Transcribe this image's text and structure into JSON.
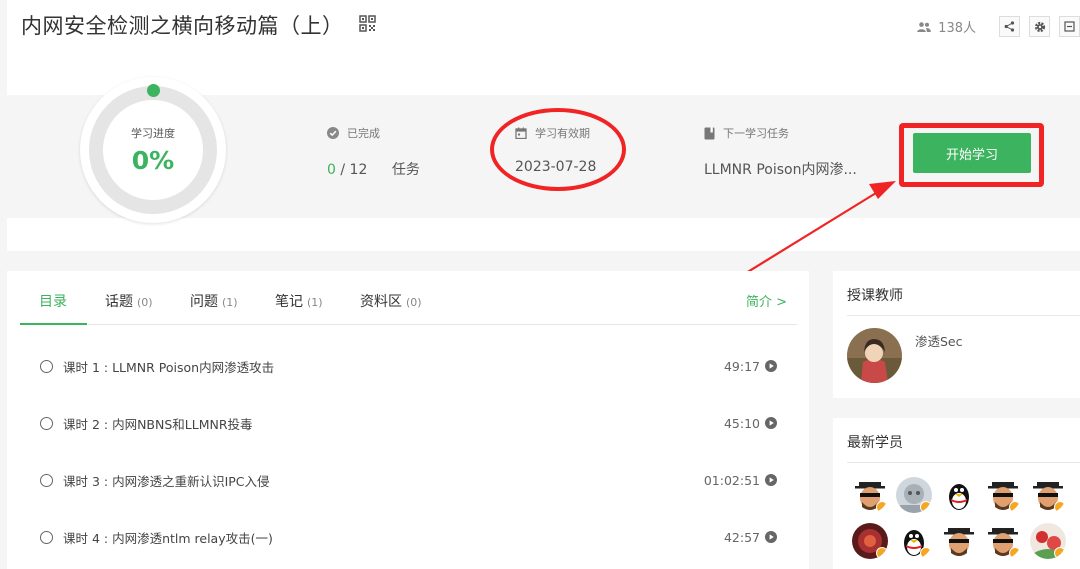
{
  "header": {
    "title": "内网安全检测之横向移动篇（上）",
    "students_count": "138人"
  },
  "progress": {
    "label": "学习进度",
    "value": "0%",
    "fraction": 0
  },
  "stats": {
    "completed": {
      "label": "已完成",
      "done": "0",
      "total": "12",
      "unit": "任务"
    },
    "valid": {
      "label": "学习有效期",
      "value": "2023-07-28"
    },
    "next": {
      "label": "下一学习任务",
      "value": "LLMNR Poison内网渗..."
    }
  },
  "start_button": "开始学习",
  "tabs": [
    {
      "label": "目录",
      "count": ""
    },
    {
      "label": "话题",
      "count": "(0)"
    },
    {
      "label": "问题",
      "count": "(1)"
    },
    {
      "label": "笔记",
      "count": "(1)"
    },
    {
      "label": "资料区",
      "count": "(0)"
    }
  ],
  "intro_link": "简介 >",
  "lessons": [
    {
      "title": "课时 1 : LLMNR Poison内网渗透攻击",
      "duration": "49:17"
    },
    {
      "title": "课时 2 : 内网NBNS和LLMNR投毒",
      "duration": "45:10"
    },
    {
      "title": "课时 3 : 内网渗透之重新认识IPC入侵",
      "duration": "01:02:51"
    },
    {
      "title": "课时 4 : 内网渗透ntlm relay攻击(一)",
      "duration": "42:57"
    }
  ],
  "teacher": {
    "section_title": "授课教师",
    "name": "渗透Sec"
  },
  "students": {
    "section_title": "最新学员"
  },
  "colors": {
    "accent": "#3cb35e",
    "annotation": "#f02424"
  }
}
